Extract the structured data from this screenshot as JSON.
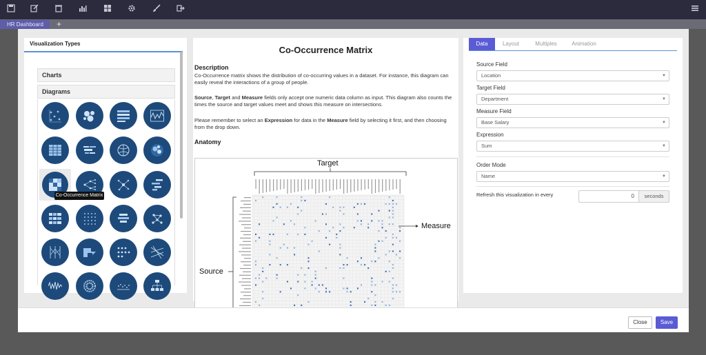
{
  "toolbar": {
    "icons": [
      "save-icon",
      "edit-icon",
      "trash-icon",
      "bar-chart-icon",
      "grid-icon",
      "gear-icon",
      "brush-icon",
      "export-icon",
      "menu-icon"
    ]
  },
  "tabs": {
    "active_tab": "HR Dashboard",
    "add_label": "+"
  },
  "left_panel": {
    "title": "Visualization Types",
    "charts_label": "Charts",
    "diagrams_label": "Diagrams",
    "tooltip": "Co-Occurrence Matrix"
  },
  "middle_panel": {
    "title": "Co-Occurrence Matrix",
    "description_heading": "Description",
    "description_text": "Co-Occurrence matrix shows the distribution of co-occurring values in a dataset. For instance, this diagram can easily reveal the interactions of a group of people.",
    "fields_text_1": "Source",
    "fields_text_2": ", ",
    "fields_text_3": "Target",
    "fields_text_4": " and ",
    "fields_text_5": "Measure",
    "fields_text_6": " fields only accept one numeric data column as input. This diagram also counts the times the source and target values meet and shows this measure on intersections.",
    "expression_text_1": "Please remember to select an ",
    "expression_text_2": "Expression",
    "expression_text_3": " for data in the ",
    "expression_text_4": "Measure",
    "expression_text_5": " field by selecting it first, and then choosing from the drop down.",
    "anatomy_heading": "Anatomy",
    "anatomy_target": "Target",
    "anatomy_measure": "Measure",
    "anatomy_source": "Source"
  },
  "right_panel": {
    "tabs": [
      "Data",
      "Layout",
      "Multiples",
      "Animation"
    ],
    "source_label": "Source Field",
    "source_value": "Location",
    "target_label": "Target Field",
    "target_value": "Department",
    "measure_label": "Measure Field",
    "measure_value": "Base Salary",
    "expression_label": "Expression",
    "expression_value": "Sum",
    "order_label": "Order Mode",
    "order_value": "Name",
    "refresh_label": "Refresh this visualization in every",
    "refresh_value": "0",
    "refresh_unit": "seconds"
  },
  "footer": {
    "close_label": "Close",
    "save_label": "Save"
  },
  "colors": {
    "toolbar_bg": "#2b2b3d",
    "accent": "#5b5bd6",
    "icon_circle": "#1d4a7a"
  }
}
